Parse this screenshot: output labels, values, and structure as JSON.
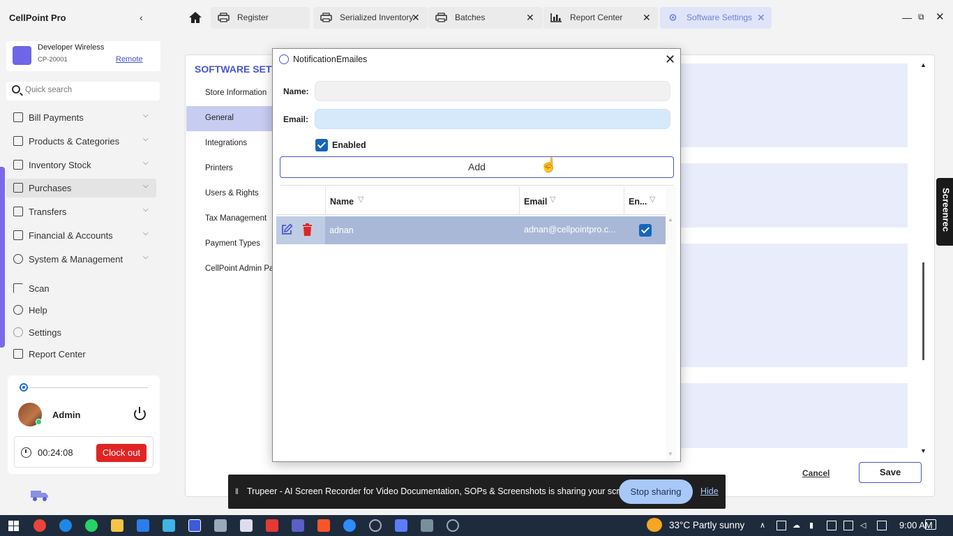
{
  "app": {
    "title": "CellPoint Pro"
  },
  "store": {
    "name": "Developer Wireless",
    "code": "CP-20001",
    "remote": "Remote"
  },
  "search": {
    "placeholder": "Quick search"
  },
  "sidebar": {
    "items": [
      {
        "label": "Bill Payments"
      },
      {
        "label": "Products & Categories"
      },
      {
        "label": "Inventory Stock"
      },
      {
        "label": "Purchases"
      },
      {
        "label": "Transfers"
      },
      {
        "label": "Financial & Accounts"
      },
      {
        "label": "System & Management"
      }
    ],
    "links": [
      {
        "label": "Scan"
      },
      {
        "label": "Help"
      },
      {
        "label": "Settings"
      },
      {
        "label": "Report Center"
      }
    ]
  },
  "user": {
    "name": "Admin",
    "timer": "00:24:08",
    "clockout": "Clock out"
  },
  "tabs": [
    {
      "label": "Register"
    },
    {
      "label": "Serialized Inventory"
    },
    {
      "label": "Batches"
    },
    {
      "label": "Report Center"
    },
    {
      "label": "Software Settings"
    }
  ],
  "settings": {
    "title": "SOFTWARE SETTI",
    "nav": [
      {
        "label": "Store Information"
      },
      {
        "label": "General"
      },
      {
        "label": "Integrations"
      },
      {
        "label": "Printers"
      },
      {
        "label": "Users & Rights"
      },
      {
        "label": "Tax Management"
      },
      {
        "label": "Payment Types"
      },
      {
        "label": "CellPoint Admin Pane"
      }
    ],
    "cancel": "Cancel",
    "save": "Save"
  },
  "dialog": {
    "title": "NotificationEmailes",
    "name_label": "Name:",
    "email_label": "Email:",
    "enabled_label": "Enabled",
    "add_label": "Add",
    "columns": [
      "Name",
      "Email",
      "En..."
    ],
    "rows": [
      {
        "name": "adnan",
        "email": "adnan@cellpointpro.c...",
        "enabled": true
      }
    ]
  },
  "screenrec": "Screenrec",
  "share": {
    "text": "Trupeer - AI Screen Recorder for Video Documentation, SOPs & Screenshots is sharing your screen.",
    "stop": "Stop sharing",
    "hide": "Hide"
  },
  "taskbar": {
    "weather": "33°C  Partly sunny",
    "time": "9:00 AM"
  },
  "colors": {
    "accent": "#4a56cf",
    "primary_blue": "#1565c0",
    "danger": "#e02424",
    "sidebar_accent": "#7a6ae8"
  }
}
